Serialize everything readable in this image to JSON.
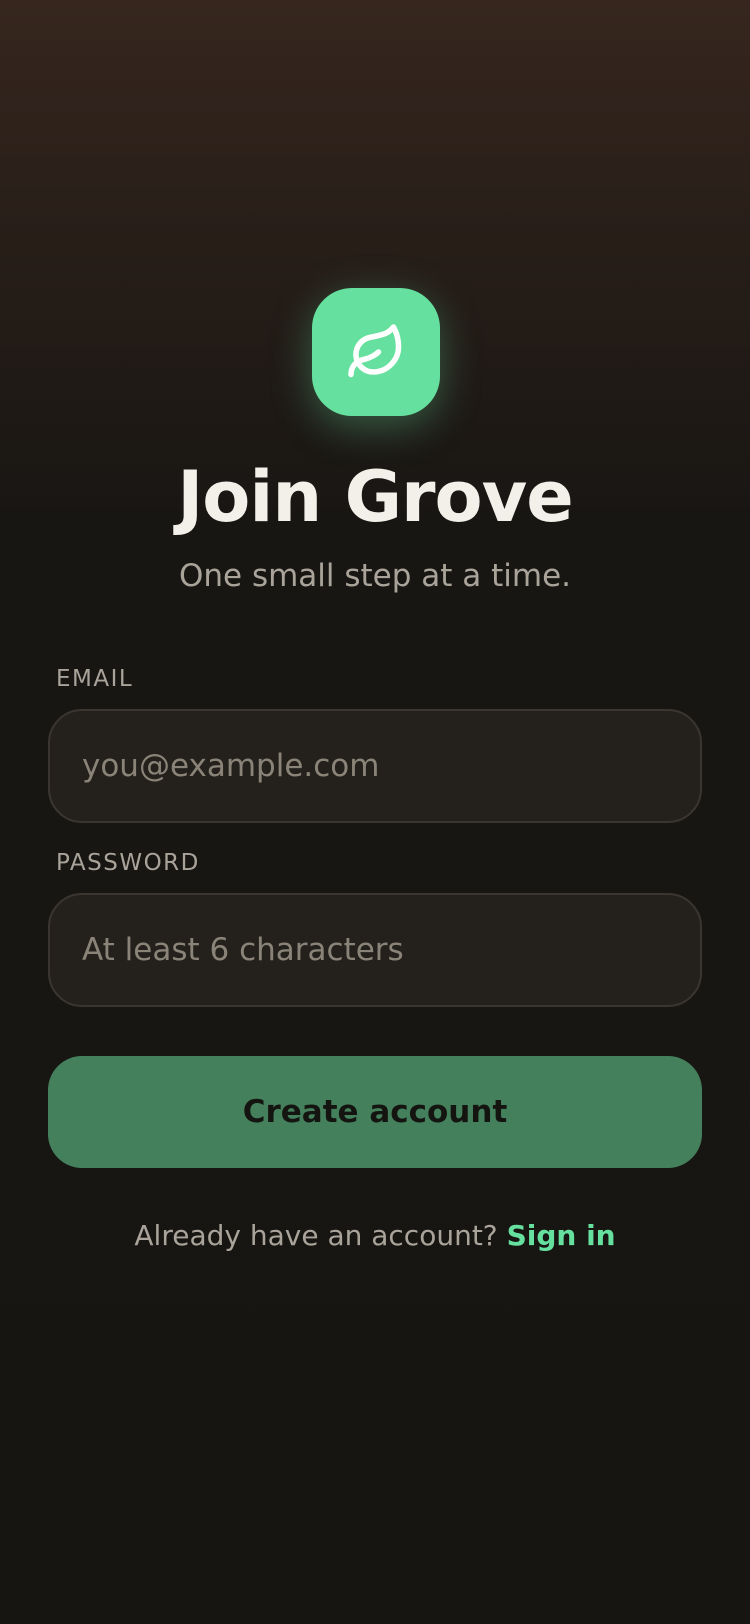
{
  "brand": {
    "icon": "leaf-icon",
    "accent_color": "#66e09f",
    "button_color": "#44805c"
  },
  "header": {
    "title": "Join Grove",
    "subtitle": "One small step at a time."
  },
  "form": {
    "email": {
      "label": "EMAIL",
      "value": "",
      "placeholder": "you@example.com"
    },
    "password": {
      "label": "PASSWORD",
      "value": "",
      "placeholder": "At least 6 characters"
    },
    "submit_label": "Create account"
  },
  "footer": {
    "prompt": "Already have an account?",
    "link_label": "Sign in"
  }
}
